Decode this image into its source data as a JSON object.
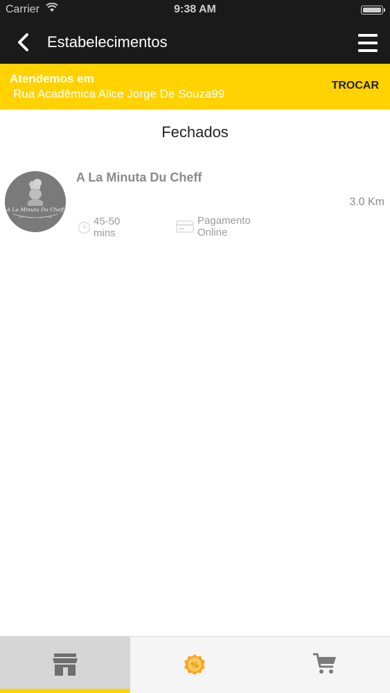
{
  "status_bar": {
    "carrier": "Carrier",
    "time": "9:38 AM"
  },
  "nav": {
    "title": "Estabelecimentos",
    "back_icon": "chevron-left-icon",
    "menu_icon": "hamburger-menu-icon"
  },
  "address_bar": {
    "label": "Atendemos em",
    "address": "Rua Acadêmica Alice Jorge De Souza99",
    "change_label": "TROCAR",
    "background_color": "#ffd200"
  },
  "section": {
    "title": "Fechados"
  },
  "stores": [
    {
      "name": "A La Minuta Du Cheff",
      "distance": "3.0 Km",
      "delivery_time_range": "45-50",
      "delivery_time_unit": "mins",
      "payment_line1": "Pagamento",
      "payment_line2": "Online",
      "logo_text": "A La Minuta Du Cheff"
    }
  ],
  "tabs": [
    {
      "id": "stores",
      "icon": "storefront-icon",
      "active": true
    },
    {
      "id": "promotions",
      "icon": "discount-badge-icon",
      "active": false
    },
    {
      "id": "cart",
      "icon": "shopping-cart-icon",
      "active": false
    }
  ],
  "colors": {
    "accent": "#ffd200",
    "header": "#1a1a1a",
    "promo_icon": "#f5a623"
  }
}
